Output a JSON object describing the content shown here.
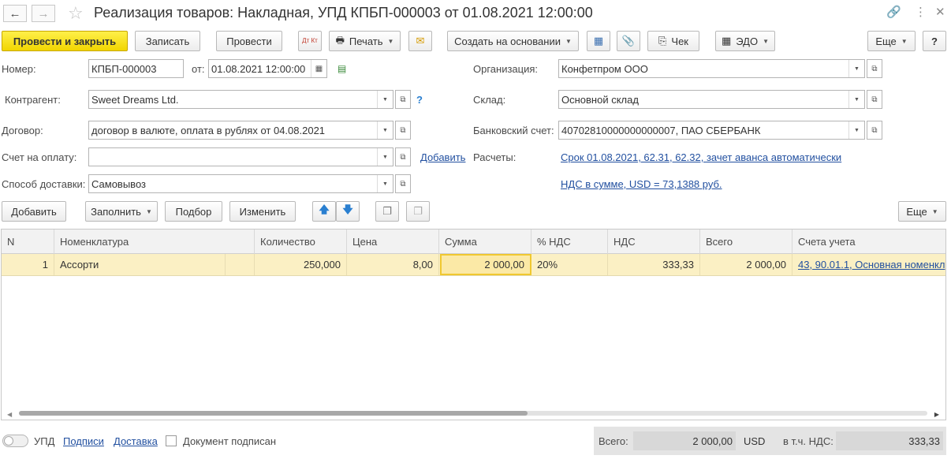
{
  "titlebar": {
    "title": "Реализация товаров: Накладная, УПД КПБП-000003 от 01.08.2021 12:00:00",
    "back_icon": "arrow-left-icon",
    "forward_icon": "arrow-right-icon",
    "favorite_icon": "star-icon"
  },
  "toolbar": {
    "post_close": "Провести и закрыть",
    "save": "Записать",
    "post": "Провести",
    "dtkt": "Дт Кт",
    "print": "Печать",
    "create_based": "Создать на основании",
    "check": "Чек",
    "edo": "ЭДО",
    "more": "Еще",
    "help": "?"
  },
  "form": {
    "number_label": "Номер:",
    "number_value": "КПБП-000003",
    "from_label": "от:",
    "date_value": "01.08.2021 12:00:00",
    "counterparty_label": "Контрагент:",
    "counterparty_value": "Sweet Dreams Ltd.",
    "counterparty_help": "?",
    "contract_label": "Договор:",
    "contract_value": "договор в валюте, оплата в рублях от 04.08.2021",
    "invoice_label": "Счет на оплату:",
    "invoice_value": "",
    "add_link": "Добавить",
    "delivery_label": "Способ доставки:",
    "delivery_value": "Самовывоз",
    "org_label": "Организация:",
    "org_value": "Конфетпром ООО",
    "warehouse_label": "Склад:",
    "warehouse_value": "Основной склад",
    "bank_label": "Банковский счет:",
    "bank_value": "40702810000000000007, ПАО СБЕРБАНК",
    "settlements_label": "Расчеты:",
    "settlements_link": "Срок 01.08.2021, 62.31, 62.32, зачет аванса автоматически",
    "vat_link": "НДС в сумме, USD = 73,1388 руб."
  },
  "table_toolbar": {
    "add": "Добавить",
    "fill": "Заполнить",
    "selection": "Подбор",
    "change": "Изменить",
    "more": "Еще"
  },
  "table": {
    "headers": {
      "n": "N",
      "item": "Номенклатура",
      "qty": "Количество",
      "price": "Цена",
      "sum": "Сумма",
      "vat_rate": "% НДС",
      "vat": "НДС",
      "total": "Всего",
      "accounts": "Счета учета"
    },
    "rows": [
      {
        "n": "1",
        "item": "Ассорти",
        "qty": "250,000",
        "price": "8,00",
        "sum": "2 000,00",
        "vat_rate": "20%",
        "vat": "333,33",
        "total": "2 000,00",
        "accounts": "43, 90.01.1, Основная номенкл"
      }
    ]
  },
  "footer": {
    "upd_label": "УПД",
    "signatures_link": "Подписи",
    "delivery_link": "Доставка",
    "signed_label": "Документ подписан",
    "total_label": "Всего:",
    "total_value": "2 000,00",
    "currency": "USD",
    "vat_label": "в т.ч. НДС:",
    "vat_value": "333,33"
  }
}
